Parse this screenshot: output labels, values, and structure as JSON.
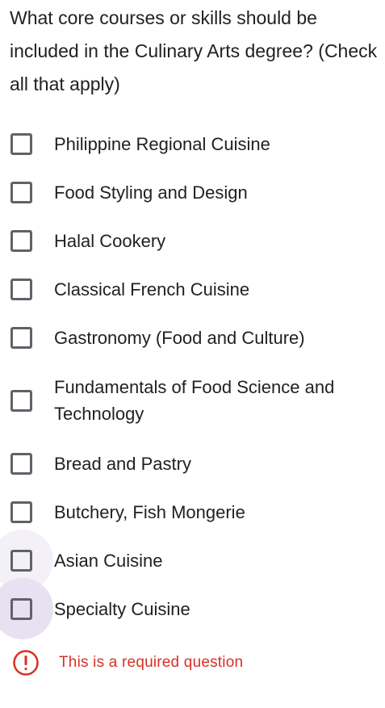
{
  "question": {
    "title": "What core courses or skills should be included in the Culinary Arts degree? (Check all that apply)"
  },
  "options": [
    {
      "label": "Philippine Regional Cuisine",
      "checked": false
    },
    {
      "label": "Food Styling and Design",
      "checked": false
    },
    {
      "label": "Halal Cookery",
      "checked": false
    },
    {
      "label": "Classical French Cuisine",
      "checked": false
    },
    {
      "label": "Gastronomy (Food and Culture)",
      "checked": false
    },
    {
      "label": "Fundamentals of Food Science and Technology",
      "checked": false
    },
    {
      "label": "Bread and Pastry",
      "checked": false
    },
    {
      "label": "Butchery, Fish Mongerie",
      "checked": false
    },
    {
      "label": "Asian Cuisine",
      "checked": false
    },
    {
      "label": "Specialty Cuisine",
      "checked": false
    }
  ],
  "validation": {
    "icon": "error-icon",
    "message": "This is a required question",
    "color": "#d93025"
  }
}
